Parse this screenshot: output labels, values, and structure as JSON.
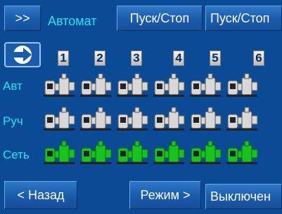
{
  "header": {
    "nav_label": ">>",
    "mode_label": "Автомат",
    "start_stop_1": "Пуск/Стоп",
    "start_stop_2": "Пуск/Стоп"
  },
  "columns": [
    "1",
    "2",
    "3",
    "4",
    "5",
    "6"
  ],
  "rows": [
    {
      "label": "Авт",
      "state": "inactive"
    },
    {
      "label": "Руч",
      "state": "inactive"
    },
    {
      "label": "Сеть",
      "state": "active"
    }
  ],
  "footer": {
    "back_label": "< Назад",
    "mode_label": "Режим >",
    "status_label": "Выключен"
  },
  "colors": {
    "background": "#0b4a94",
    "label_cyan": "#1fe6f5",
    "pump_active": "#19c21e",
    "pump_inactive": "#d8d8d8"
  },
  "icons": {
    "arrow": "arrow-right-icon",
    "pump": "pump-icon"
  }
}
